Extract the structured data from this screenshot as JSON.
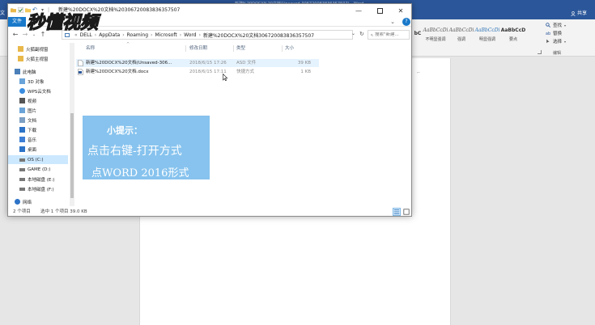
{
  "word": {
    "title": "新建%20DOCX%20文档(Unsaved-306720083836357507) - Word",
    "file_tab": "文",
    "share": "共享",
    "styles": [
      {
        "sample": "bC",
        "label": "",
        "variant": "bold"
      },
      {
        "sample": "AaBbCcDi",
        "label": "不明显强调",
        "variant": "italic"
      },
      {
        "sample": "AaBbCcDi",
        "label": "强调",
        "variant": "italic"
      },
      {
        "sample": "AaBbCcDi",
        "label": "明显强调",
        "variant": "blue"
      },
      {
        "sample": "AaBbCcD",
        "label": "要点",
        "variant": "bold"
      }
    ],
    "styles_group_label": "",
    "editing": {
      "find": "查找",
      "replace": "替换",
      "select": "选择",
      "group_label": "编辑"
    }
  },
  "explorer": {
    "title": "新建%20DOCX%20文档%20306720083836357507",
    "file_tab": "文件",
    "breadcrumb": [
      "DELL",
      "AppData",
      "Roaming",
      "Microsoft",
      "Word",
      "新建%20DOCX%20文档306720083836357507"
    ],
    "search_placeholder": "搜索\"新建...",
    "sidebar": [
      {
        "label": "火狐副视窗",
        "icon": "folder-icon"
      },
      {
        "label": "火狐主视窗",
        "icon": "folder-icon"
      },
      {
        "label": "此电脑",
        "icon": "computer-icon"
      },
      {
        "label": "3D 对象",
        "icon": "cube-icon"
      },
      {
        "label": "WPS云文档",
        "icon": "cloud-icon"
      },
      {
        "label": "视频",
        "icon": "video-icon"
      },
      {
        "label": "图片",
        "icon": "picture-icon"
      },
      {
        "label": "文档",
        "icon": "document-icon"
      },
      {
        "label": "下载",
        "icon": "download-icon"
      },
      {
        "label": "音乐",
        "icon": "music-icon"
      },
      {
        "label": "桌面",
        "icon": "desktop-icon"
      },
      {
        "label": "OS (C:)",
        "icon": "drive-icon"
      },
      {
        "label": "GAME (D:)",
        "icon": "drive-icon"
      },
      {
        "label": "本地磁盘 (E:)",
        "icon": "drive-icon"
      },
      {
        "label": "本地磁盘 (F:)",
        "icon": "drive-icon"
      },
      {
        "label": "网络",
        "icon": "network-icon"
      }
    ],
    "columns": {
      "name": "名称",
      "date": "修改日期",
      "type": "类型",
      "size": "大小"
    },
    "files": [
      {
        "name": "新建%20DOCX%20文档(Unsaved-306...",
        "date": "2018/6/15 17:26",
        "type": "ASD 文件",
        "size": "39 KB"
      },
      {
        "name": "新建%20DOCX%20文档.docx",
        "date": "2018/6/15 17:11",
        "type": "快捷方式",
        "size": "1 KB"
      }
    ],
    "status": {
      "count": "2 个项目",
      "selection": "选中 1 个项目  39.0 KB"
    }
  },
  "tip": {
    "title": "小提示：",
    "line1": "点击右键-打开方式",
    "line2": "点WORD 2016形式"
  },
  "logo_text": "秒懂视频",
  "colors": {
    "word_blue": "#2b579a",
    "explorer_accent": "#1979ca",
    "tip_bg": "#87c3ee",
    "selection": "#cce8ff"
  }
}
